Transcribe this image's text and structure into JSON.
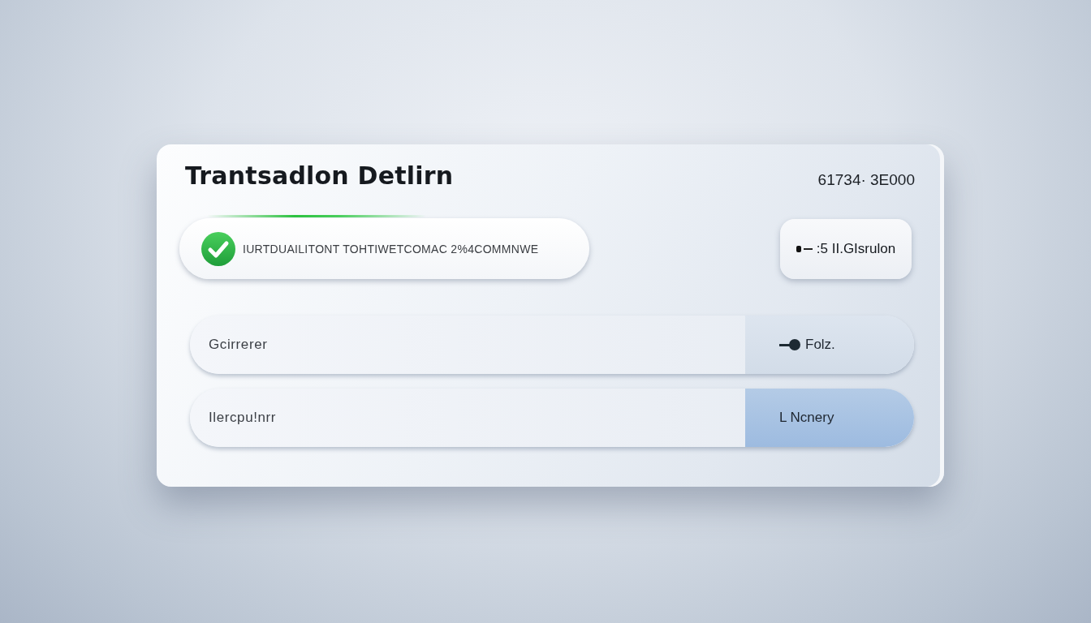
{
  "card": {
    "title": "Trantsadlon Detlirn",
    "amount": "61734· 3E000"
  },
  "status": {
    "kind": "success",
    "text": "IURTDUAILITONT TOHTIWETCOMAC 2%4COMMNWE"
  },
  "action_button": {
    "label": ":5 II.GIsrulon"
  },
  "rows": [
    {
      "kind": "marker",
      "label": "Gcirrerer",
      "value": "Folz.",
      "selected": false
    },
    {
      "kind": "plain",
      "label": "Ilercpu!nrr",
      "value": "L Ncnery",
      "selected": true
    }
  ]
}
